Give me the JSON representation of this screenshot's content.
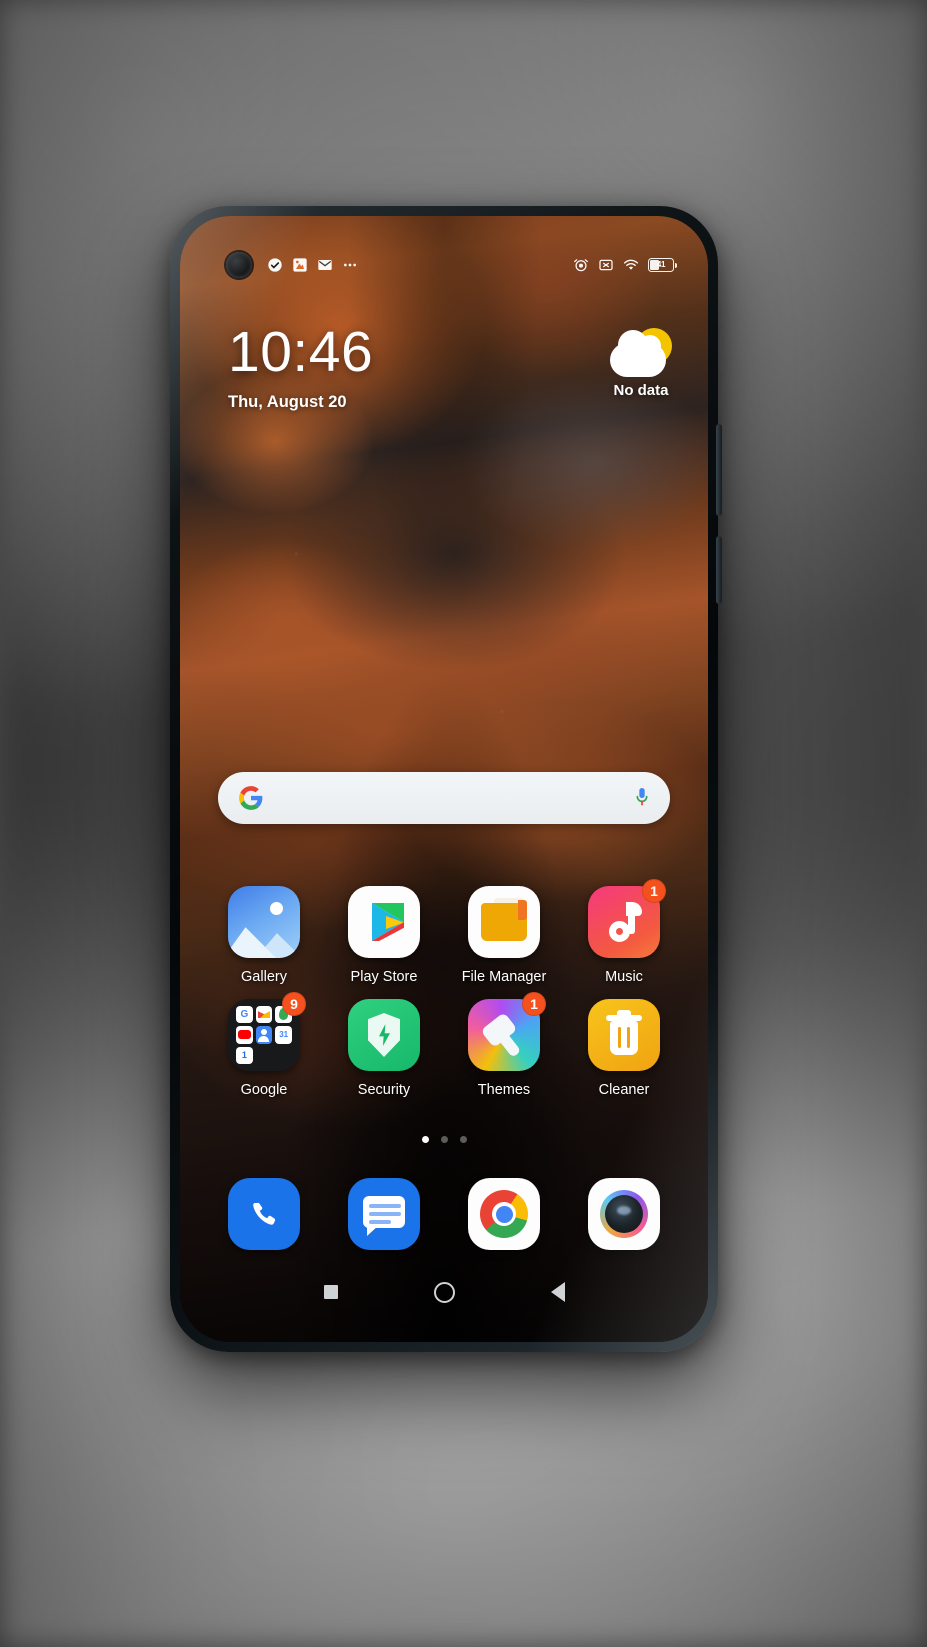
{
  "status_bar": {
    "left_icons": [
      "check-circle-icon",
      "app-notification-icon",
      "gmail-icon",
      "more-dots-icon"
    ],
    "right_icons": [
      "alarm-icon",
      "silent-mode-icon",
      "wifi-icon",
      "battery-icon"
    ],
    "battery_level": "41"
  },
  "clock_widget": {
    "time": "10:46",
    "date": "Thu, August 20",
    "weather_label": "No data",
    "weather_icon": "sun-behind-cloud-icon"
  },
  "search": {
    "logo": "google-g-icon",
    "mic": "microphone-icon",
    "placeholder": ""
  },
  "home_rows": [
    {
      "apps": [
        {
          "label": "Gallery",
          "icon": "gallery-icon",
          "badge": ""
        },
        {
          "label": "Play Store",
          "icon": "play-store-icon",
          "badge": ""
        },
        {
          "label": "File Manager",
          "icon": "file-manager-icon",
          "badge": ""
        },
        {
          "label": "Music",
          "icon": "music-icon",
          "badge": "1"
        }
      ]
    },
    {
      "apps": [
        {
          "label": "Google",
          "icon": "google-folder-icon",
          "badge": "9"
        },
        {
          "label": "Security",
          "icon": "security-shield-icon",
          "badge": ""
        },
        {
          "label": "Themes",
          "icon": "themes-brush-icon",
          "badge": "1"
        },
        {
          "label": "Cleaner",
          "icon": "cleaner-trash-icon",
          "badge": ""
        }
      ]
    }
  ],
  "google_folder_minis": [
    "G",
    "M",
    "maps",
    "yt",
    "contacts",
    "31",
    "1"
  ],
  "page_indicator": {
    "count": 3,
    "active": 1
  },
  "dock": [
    {
      "label": "",
      "icon": "phone-icon"
    },
    {
      "label": "",
      "icon": "messages-icon"
    },
    {
      "label": "",
      "icon": "chrome-icon"
    },
    {
      "label": "",
      "icon": "camera-icon"
    }
  ],
  "nav_bar": [
    "recents-square-icon",
    "home-circle-icon",
    "back-triangle-icon"
  ],
  "colors": {
    "badge": "#f4511e",
    "accent_blue": "#1a73e8",
    "security_green": "#17b86a",
    "cleaner_yellow": "#f8c41b"
  }
}
